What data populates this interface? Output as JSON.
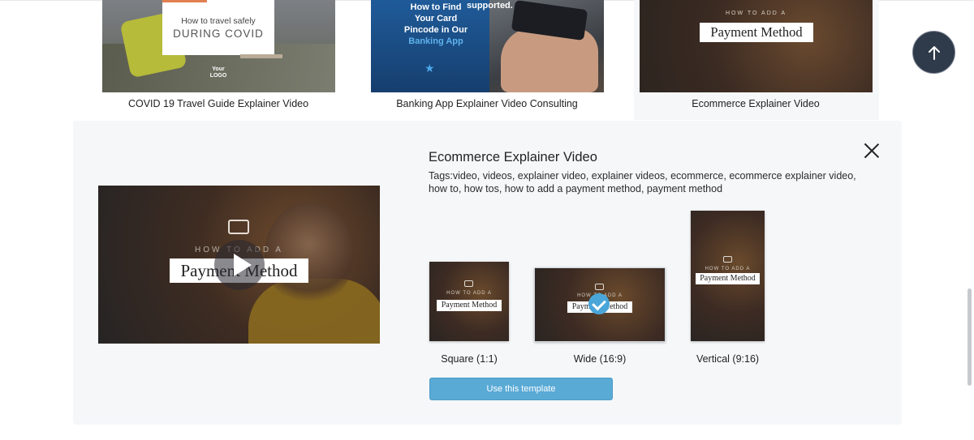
{
  "cards": [
    {
      "label": "COVID 19 Travel Guide Explainer Video",
      "thumb_subtitle": "How to travel safely",
      "thumb_title": "DURING COVID",
      "thumb_logo_top": "Your",
      "thumb_logo_bottom": "LOGO"
    },
    {
      "label": "Banking App Explainer Video Consulting",
      "thumb_line1": "How to Find",
      "thumb_line2": "Your Card",
      "thumb_line3": "Pincode in Our",
      "thumb_line4": "Banking App",
      "thumb_supported": "supported."
    },
    {
      "label": "Ecommerce Explainer Video",
      "thumb_subtitle": "HOW TO ADD A",
      "thumb_title": "Payment Method"
    }
  ],
  "panel": {
    "title": "Ecommerce Explainer Video",
    "tags": "Tags:video, videos, explainer video, explainer videos, ecommerce, ecommerce explainer video, how to, how tos, how to add a payment method, payment method",
    "preview": {
      "subtitle": "HOW TO ADD A",
      "title": "Payment Method"
    },
    "formats": [
      {
        "label": "Square (1:1)",
        "subtitle": "HOW TO ADD A",
        "title": "Payment Method"
      },
      {
        "label": "Wide (16:9)",
        "subtitle": "HOW TO ADD A",
        "title": "Payment Method",
        "selected": true
      },
      {
        "label": "Vertical (9:16)",
        "subtitle": "HOW TO ADD A",
        "title": "Payment Method"
      }
    ],
    "use_button": "Use this template"
  },
  "scroll_top_icon": "arrow-up-icon",
  "colors": {
    "accent": "#5aaad6",
    "scroll_top_bg": "#2f3a4a",
    "panel_bg": "#f5f7f9"
  }
}
